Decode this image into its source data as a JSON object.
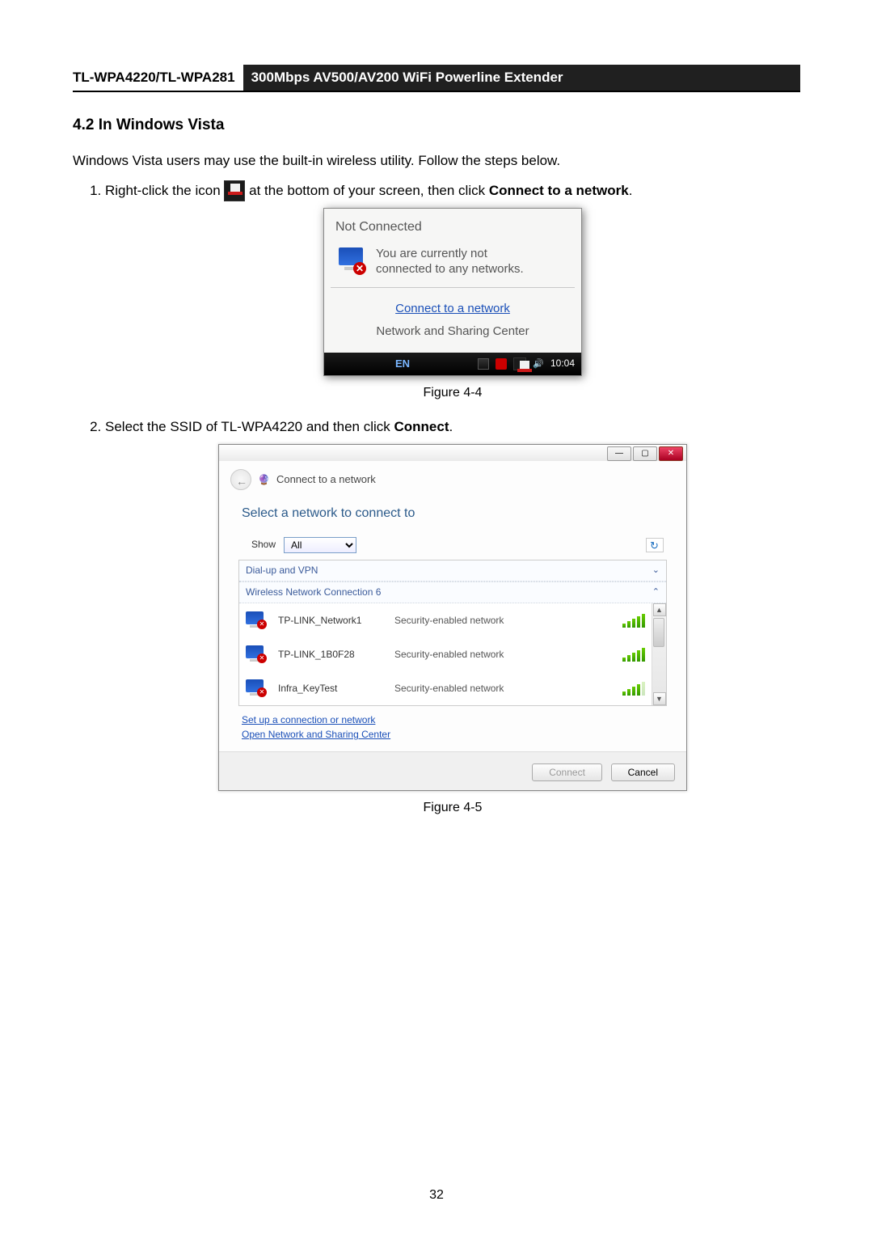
{
  "header": {
    "model": "TL-WPA4220/TL-WPA281",
    "product": "300Mbps AV500/AV200 WiFi Powerline Extender"
  },
  "section": {
    "number_title": "4.2 In Windows Vista",
    "intro": "Windows Vista users may use the built-in wireless utility. Follow the steps below."
  },
  "step1": {
    "pre": "Right-click the icon ",
    "post": " at the bottom of your screen, then click ",
    "bold": "Connect to a network",
    "end": "."
  },
  "fig44": {
    "caption": "Figure 4-4",
    "title": "Not Connected",
    "msg1": "You are currently not",
    "msg2": "connected to any networks.",
    "link": "Connect to a network",
    "sub": "Network and Sharing Center",
    "lang": "EN",
    "time": "10:04"
  },
  "step2": {
    "text_pre": "Select the SSID of TL-WPA4220 and then click ",
    "bold": "Connect",
    "end": "."
  },
  "fig45": {
    "caption": "Figure 4-5",
    "crumb": "Connect to a network",
    "prompt": "Select a network to connect to",
    "show_label": "Show",
    "show_value": "All",
    "cat_dial": "Dial-up and VPN",
    "cat_wlan": "Wireless Network Connection 6",
    "networks": [
      {
        "name": "TP-LINK_Network1",
        "sec": "Security-enabled network",
        "bars": 5
      },
      {
        "name": "TP-LINK_1B0F28",
        "sec": "Security-enabled network",
        "bars": 5
      },
      {
        "name": "Infra_KeyTest",
        "sec": "Security-enabled network",
        "bars": 4
      }
    ],
    "link_setup": "Set up a connection or network",
    "link_open": "Open Network and Sharing Center",
    "btn_connect": "Connect",
    "btn_cancel": "Cancel"
  },
  "page_number": "32"
}
